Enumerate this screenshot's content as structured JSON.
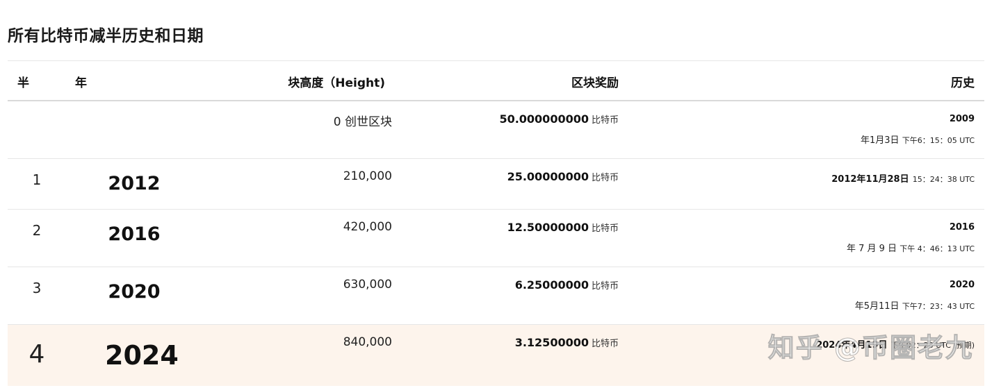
{
  "page": {
    "title": "所有比特币减半历史和日期"
  },
  "table": {
    "headers": {
      "half": "半",
      "year": "年",
      "height": "块高度（Height)",
      "reward": "区块奖励",
      "history": "历史"
    },
    "rows": [
      {
        "half": "",
        "year": "",
        "height": "0 创世区块",
        "reward_value": "50.000000000",
        "reward_unit": "比特币",
        "history_line1": "2009",
        "history_line2_date": "年1月3日",
        "history_line2_time": "下午6：15：05 UTC"
      },
      {
        "half": "1",
        "year": "2012",
        "height": "210,000",
        "reward_value": "25.00000000",
        "reward_unit": "比特币",
        "history_bold": "2012年11月28日",
        "history_time": "15：24：38 UTC"
      },
      {
        "half": "2",
        "year": "2016",
        "height": "420,000",
        "reward_value": "12.50000000",
        "reward_unit": "比特币",
        "history_line1": "2016",
        "history_line2_date": "年 7 月 9 日",
        "history_line2_time": "下午 4：46：13 UTC"
      },
      {
        "half": "3",
        "year": "2020",
        "height": "630,000",
        "reward_value": "6.25000000",
        "reward_unit": "比特币",
        "history_line1": "2020",
        "history_line2_date": "年5月11日",
        "history_line2_time": "下午7：23：43 UTC"
      },
      {
        "half": "4",
        "year": "2024",
        "height": "840,000",
        "reward_value": "3.12500000",
        "reward_unit": "比特币",
        "history_bold": "2024年4月19日",
        "history_time": "下午02：28 UTC (预期)"
      }
    ]
  },
  "watermark": "知乎 @币圈老九"
}
